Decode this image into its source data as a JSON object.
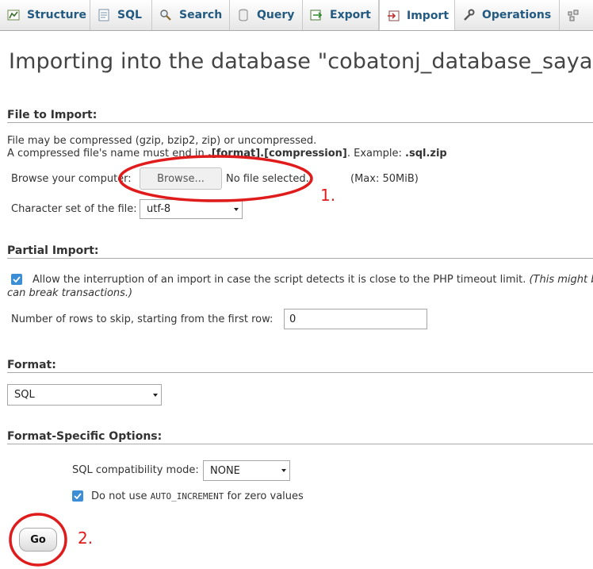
{
  "tabs": [
    {
      "label": "Structure",
      "icon": "structure-icon",
      "active": false
    },
    {
      "label": "SQL",
      "icon": "sql-icon",
      "active": false
    },
    {
      "label": "Search",
      "icon": "search-icon",
      "active": false
    },
    {
      "label": "Query",
      "icon": "query-icon",
      "active": false
    },
    {
      "label": "Export",
      "icon": "export-icon",
      "active": false
    },
    {
      "label": "Import",
      "icon": "import-icon",
      "active": true
    },
    {
      "label": "Operations",
      "icon": "operations-icon",
      "active": false
    },
    {
      "label": "",
      "icon": "more-icon",
      "active": false
    }
  ],
  "page": {
    "title": "Importing into the database \"cobatonj_database_saya\""
  },
  "file_import": {
    "heading": "File to Import:",
    "line1": "File may be compressed (gzip, bzip2, zip) or uncompressed.",
    "line2_prefix": "A compressed file's name must end in ",
    "line2_format": ".[format].[compression]",
    "line2_middle": ". Example: ",
    "line2_example": ".sql.zip",
    "browse_label": "Browse your computer:",
    "browse_button": "Browse...",
    "no_file": "No file selected.",
    "max_size": "(Max: 50MiB)",
    "charset_label": "Character set of the file:",
    "charset_value": "utf-8"
  },
  "partial_import": {
    "heading": "Partial Import:",
    "allow_interrupt_text": "Allow the interruption of an import in case the script detects it is close to the PHP timeout limit.",
    "allow_interrupt_note": "(This might b",
    "allow_interrupt_note_line2": "can break transactions.)",
    "allow_interrupt_checked": true,
    "skip_label": "Number of rows to skip, starting from the first row:",
    "skip_value": "0"
  },
  "format": {
    "heading": "Format:",
    "value": "SQL"
  },
  "format_options": {
    "heading": "Format-Specific Options:",
    "compat_label": "SQL compatibility mode:",
    "compat_value": "NONE",
    "auto_increment_prefix": "Do not use ",
    "auto_increment_code": "AUTO_INCREMENT",
    "auto_increment_suffix": " for zero values",
    "auto_increment_checked": true
  },
  "actions": {
    "go_label": "Go"
  },
  "annotations": {
    "label1": "1.",
    "label2": "2.",
    "color": "#e01b1b"
  },
  "colors": {
    "tab_text": "#235a81",
    "checkbox": "#3b8ed6"
  }
}
